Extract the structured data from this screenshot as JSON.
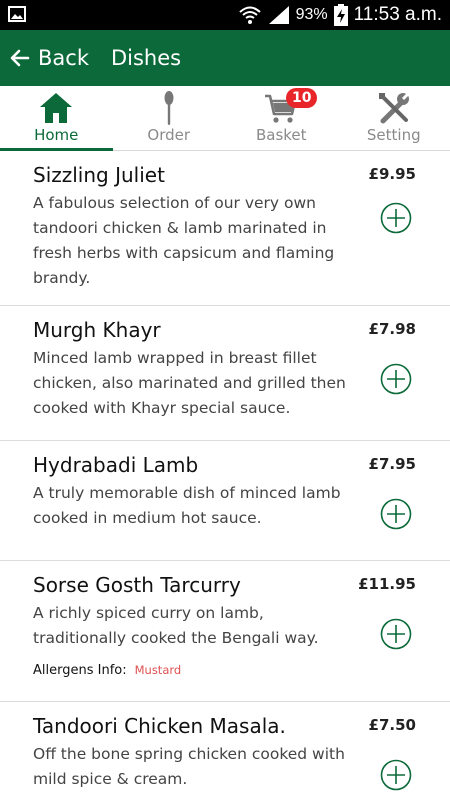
{
  "status_bar": {
    "battery": "93%",
    "time": "11:53 a.m."
  },
  "app_bar": {
    "back_label": "Back",
    "title": "Dishes",
    "color": "#0c6a3a"
  },
  "tabs": [
    {
      "label": "Home",
      "icon": "home-icon",
      "active": true
    },
    {
      "label": "Order",
      "icon": "spoon-icon",
      "active": false
    },
    {
      "label": "Basket",
      "icon": "cart-icon",
      "active": false,
      "badge": "10"
    },
    {
      "label": "Setting",
      "icon": "tools-icon",
      "active": false
    }
  ],
  "dishes": [
    {
      "name": "Sizzling Juliet",
      "price": "£9.95",
      "description": "A fabulous selection of our very own tandoori chicken & lamb marinated in fresh herbs with capsicum and flaming brandy."
    },
    {
      "name": "Murgh Khayr",
      "price": "£7.98",
      "description": "Minced lamb wrapped in breast fillet chicken, also marinated and grilled then cooked with Khayr special sauce."
    },
    {
      "name": "Hydrabadi Lamb",
      "price": "£7.95",
      "description": "A truly memorable dish of minced lamb cooked in medium hot sauce."
    },
    {
      "name": "Sorse Gosth Tarcurry",
      "price": "£11.95",
      "description": "A richly spiced curry on lamb, traditionally cooked the Bengali way.",
      "allergens_label": "Allergens Info:",
      "allergens": "Mustard"
    },
    {
      "name": "Tandoori Chicken Masala.",
      "price": "£7.50",
      "description": "Off the bone spring chicken cooked with mild spice & cream."
    }
  ]
}
